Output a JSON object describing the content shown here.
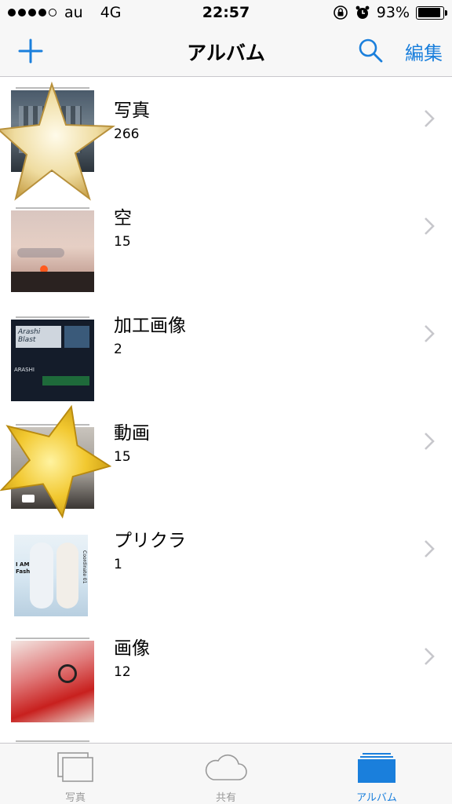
{
  "status_bar": {
    "carrier": "au",
    "network": "4G",
    "time": "22:57",
    "battery": "93%",
    "battery_level": 0.93,
    "signal_bars": 4,
    "signal_total": 5,
    "icons": [
      "orientation-lock-icon",
      "alarm-icon"
    ]
  },
  "nav": {
    "title": "アルバム",
    "edit_label": "編集",
    "add_icon": "plus-icon",
    "search_icon": "search-icon"
  },
  "albums": [
    {
      "name": "写真",
      "count": "266"
    },
    {
      "name": "空",
      "count": "15"
    },
    {
      "name": "加工画像",
      "count": "2"
    },
    {
      "name": "動画",
      "count": "15"
    },
    {
      "name": "プリクラ",
      "count": "1"
    },
    {
      "name": "画像",
      "count": "12"
    }
  ],
  "thumbnail_text": {
    "edited_1": "Arashi Blast",
    "edited_2": "ARASHI",
    "purikura_1": "I AM",
    "purikura_2": "Fashionista",
    "purikura_3": "Coordinate 01"
  },
  "tabs": [
    {
      "label": "写真",
      "icon": "photos-icon",
      "active": false
    },
    {
      "label": "共有",
      "icon": "cloud-icon",
      "active": false
    },
    {
      "label": "アルバム",
      "icon": "albums-icon",
      "active": true
    }
  ],
  "colors": {
    "accent": "#1a7fdc",
    "bar_background": "#f7f7f7",
    "inactive_tab": "#999999"
  }
}
